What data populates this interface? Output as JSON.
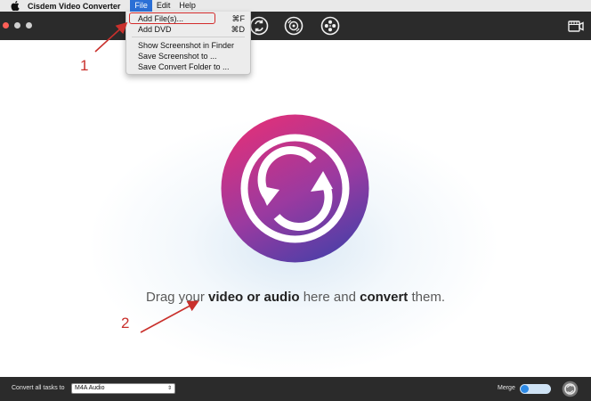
{
  "menubar": {
    "app_name": "Cisdem Video Converter",
    "menus": [
      "File",
      "Edit",
      "Help"
    ],
    "active_menu": "File"
  },
  "file_menu": {
    "items": [
      {
        "label": "Add File(s)...",
        "shortcut": "⌘F"
      },
      {
        "label": "Add DVD",
        "shortcut": "⌘D"
      },
      {
        "label": "Show Screenshot in Finder",
        "shortcut": ""
      },
      {
        "label": "Save Screenshot to ...",
        "shortcut": ""
      },
      {
        "label": "Save Convert Folder to ...",
        "shortcut": ""
      }
    ]
  },
  "toolbar": {
    "icons": [
      "convert-mode-icon",
      "rip-mode-icon",
      "film-reel-icon",
      "screen-record-icon"
    ]
  },
  "main": {
    "drag_prefix": "Drag your",
    "drag_media": "video or audio",
    "drag_middle": "here and",
    "drag_action": "convert",
    "drag_suffix": "them."
  },
  "annotations": {
    "step1": "1",
    "step2": "2",
    "color": "#c9302c"
  },
  "bottombar": {
    "convert_label": "Convert all tasks to",
    "format_value": "M4A Audio",
    "merge_label": "Merge",
    "merge_enabled": false
  },
  "colors": {
    "accent_blue": "#2b6fd6",
    "toolbar_dark": "#2b2b2b",
    "logo_pink": "#e0307a",
    "logo_purple": "#5a3ea8",
    "highlight_red": "#d32b2b"
  }
}
